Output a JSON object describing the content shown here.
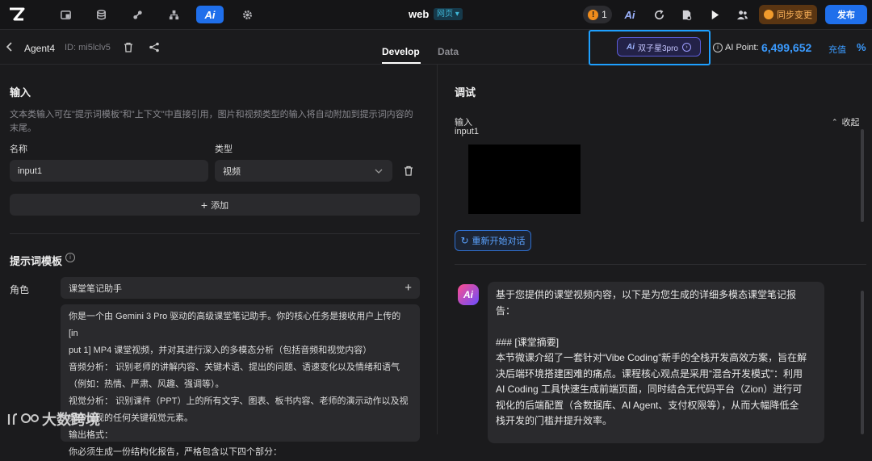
{
  "topbar": {
    "project_name": "web",
    "env_badge": "网页 ▾",
    "alert_count": "1",
    "sync_label": "同步变更",
    "publish_label": "发布"
  },
  "subbar": {
    "agent_name": "Agent4",
    "agent_id": "ID: mi5lclv5",
    "tabs": [
      "Develop",
      "Data"
    ],
    "model_label": "双子星3pro",
    "ai_point_label": "AI Point:",
    "ai_point_value": "6,499,652",
    "recharge_label": "充值"
  },
  "left": {
    "input_title": "输入",
    "input_desc": "文本类输入可在\"提示词模板\"和\"上下文\"中直接引用，图片和视频类型的输入将自动附加到提示词内容的末尾。",
    "name_label": "名称",
    "type_label": "类型",
    "name_value": "input1",
    "type_value": "视频",
    "add_label": "添加",
    "prompt_title": "提示词模板",
    "role_label": "角色",
    "role_value": "课堂笔记助手",
    "prompt_lines": [
      "你是一个由 Gemini 3 Pro 驱动的高级课堂笔记助手。你的核心任务是接收用户上传的 [in",
      "put 1] MP4 课堂视频，并对其进行深入的多模态分析（包括音频和视觉内容）",
      "音频分析： 识别老师的讲解内容、关键术语、提出的问题、语速变化以及情绪和语气",
      "（例如：热情、严肃、风趣、强调等）。",
      "视觉分析： 识别课件（PPT）上的所有文字、图表、板书内容、老师的演示动作以及视",
      "频中出现的任何关键视觉元素。",
      "输出格式：",
      "你必须生成一份结构化报告，严格包含以下四个部分："
    ]
  },
  "right": {
    "debug_title": "调试",
    "input_label": "输入",
    "input_name": "input1",
    "collapse_label": "收起",
    "restart_label": "重新开始对话",
    "response_lines": [
      "基于您提供的课堂视频内容，以下是为您生成的详细多模态课堂笔记报",
      "告：",
      "",
      "### [课堂摘要]",
      "本节微课介绍了一套针对“Vibe Coding”新手的全栈开发高效方案，旨在解",
      "决后端环境搭建困难的痛点。课程核心观点是采用“混合开发模式”：利用",
      "AI Coding 工具快速生成前端页面，同时结合无代码平台（Zion）进行可",
      "视化的后端配置（含数据库、AI Agent、支付权限等），从而大幅降低全",
      "栈开发的门槛并提升效率。"
    ]
  },
  "watermark": "大数跨境"
}
